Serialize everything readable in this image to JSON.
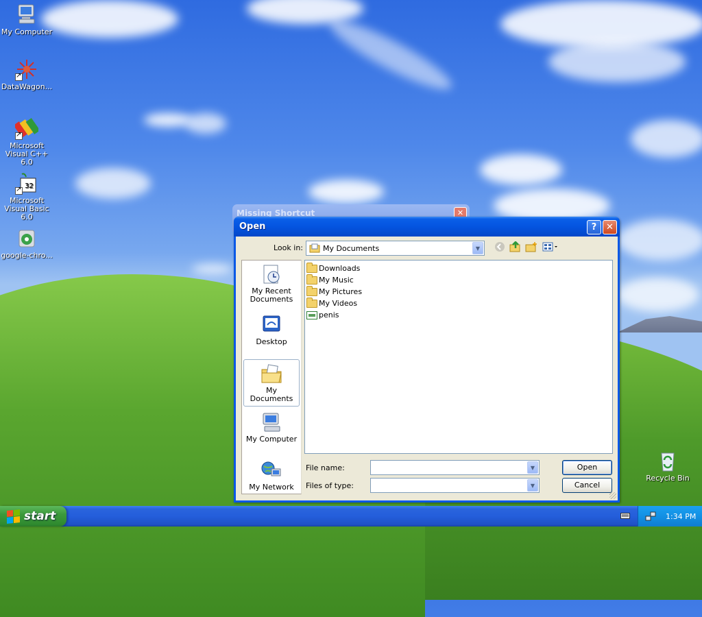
{
  "desktop": {
    "icons": [
      {
        "label": "My Computer",
        "icon": "my-computer-icon"
      },
      {
        "label": "DataWagon...",
        "icon": "datawagon-icon"
      },
      {
        "label": "Microsoft Visual C++ 6.0",
        "icon": "visual-cpp-icon"
      },
      {
        "label": "Microsoft Visual Basic 6.0",
        "icon": "visual-basic-icon"
      },
      {
        "label": "google-chro...",
        "icon": "google-chrome-installer-icon"
      },
      {
        "label": "Recycle Bin",
        "icon": "recycle-bin-icon"
      }
    ]
  },
  "background_window": {
    "title": "Missing Shortcut"
  },
  "dialog": {
    "title": "Open",
    "help_label": "?",
    "close_label": "✕",
    "look_in_label": "Look in:",
    "look_in_value": "My Documents",
    "places": [
      {
        "label": "My Recent Documents",
        "icon": "recent-documents-icon"
      },
      {
        "label": "Desktop",
        "icon": "desktop-icon"
      },
      {
        "label": "My Documents",
        "icon": "my-documents-icon",
        "selected": true
      },
      {
        "label": "My Computer",
        "icon": "my-computer-icon"
      },
      {
        "label": "My Network",
        "icon": "my-network-icon"
      }
    ],
    "files": [
      {
        "name": "Downloads",
        "type": "folder"
      },
      {
        "name": "My Music",
        "type": "folder"
      },
      {
        "name": "My Pictures",
        "type": "folder"
      },
      {
        "name": "My Videos",
        "type": "folder"
      },
      {
        "name": "penis",
        "type": "file"
      }
    ],
    "file_name_label": "File name:",
    "file_name_value": "",
    "files_of_type_label": "Files of type:",
    "files_of_type_value": "",
    "open_label": "Open",
    "cancel_label": "Cancel"
  },
  "taskbar": {
    "start_label": "start",
    "clock": "1:34 PM"
  },
  "colors": {
    "title_blue": "#0454e0",
    "start_green": "#3c9a3c",
    "dialog_face": "#ece9d8"
  }
}
